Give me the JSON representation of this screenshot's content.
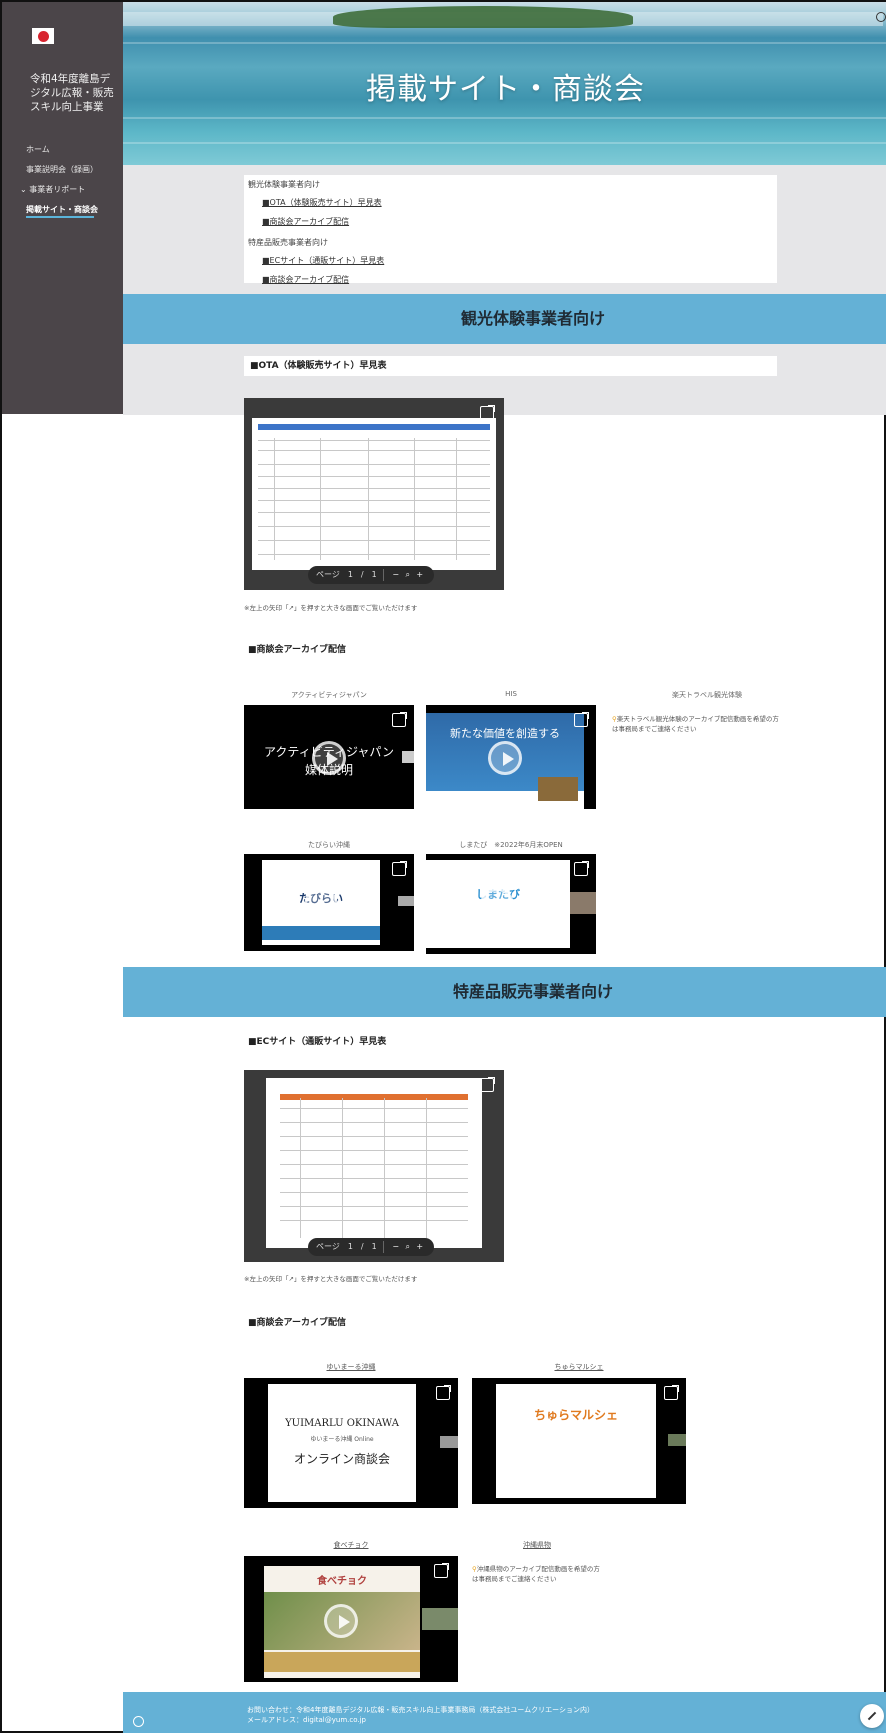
{
  "sidebar": {
    "site_title": "令和4年度離島デジタル広報・販売スキル向上事業",
    "nav": [
      {
        "label": "ホーム"
      },
      {
        "label": "事業説明会（録画）"
      },
      {
        "label": "⌄ 事業者リポート"
      },
      {
        "label": "掲載サイト・商談会"
      }
    ]
  },
  "hero": {
    "title": "掲載サイト・商談会"
  },
  "toc": {
    "group1": "観光体験事業者向け",
    "group1_links": [
      "■OTA（体験販売サイト）早見表",
      "■商談会アーカイブ配信"
    ],
    "group2": "特産品販売事業者向け",
    "group2_links": [
      "■ECサイト（通販サイト）早見表",
      "■商談会アーカイブ配信"
    ]
  },
  "section1": {
    "band_title": "観光体験事業者向け",
    "ota_heading": "■OTA（体験販売サイト）早見表",
    "viewer_page": "ページ　1　/　1",
    "note": "※左上の矢印「↗」を押すと大きな画面でご覧いただけます",
    "archive_heading": "■商談会アーカイブ配信",
    "videos": [
      {
        "caption": "アクティビティジャパン",
        "text": "アクティビティジャパン\n媒体説明"
      },
      {
        "caption": "HIS",
        "text": "新たな価値を創造する"
      },
      {
        "caption": "たびらい沖縄",
        "text": "たびらい"
      },
      {
        "caption": "しまたび　※2022年6月末OPEN",
        "text": "しまたび"
      }
    ],
    "rakuten": {
      "caption": "楽天トラベル観光体験",
      "note": "楽天トラベル観光体験のアーカイブ配信動画を希望の方は事務局までご連絡ください"
    }
  },
  "section2": {
    "band_title": "特産品販売事業者向け",
    "ec_heading": "■ECサイト（通販サイト）早見表",
    "viewer_page": "ページ　1　/　1",
    "note": "※左上の矢印「↗」を押すと大きな画面でご覧いただけます",
    "archive_heading": "■商談会アーカイブ配信",
    "videos": [
      {
        "caption": "ゆいまーる沖縄",
        "line1": "YUIMARLU OKINAWA",
        "line2": "ゆいまーる沖縄 Online",
        "line3": "オンライン商談会"
      },
      {
        "caption": "ちゅらマルシェ",
        "text": "ちゅらマルシェ"
      },
      {
        "caption": "食べチョク",
        "text": "食べチョク"
      }
    ],
    "other": {
      "caption": "沖縄県物",
      "note": "沖縄県物のアーカイブ配信動画を希望の方は事務局までご連絡ください"
    }
  },
  "footer": {
    "line1": "お問い合わせ：令和4年度離島デジタル広報・販売スキル向上事業事務局（株式会社ユームクリエーション内）",
    "line2": "メールアドレス：digital@yum.co.jp"
  }
}
